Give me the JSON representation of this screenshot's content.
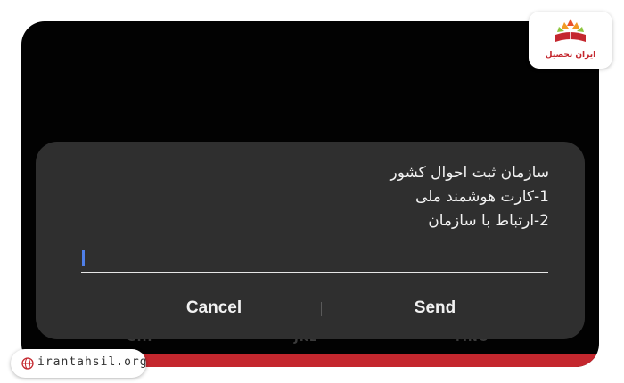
{
  "dialog": {
    "message_lines": [
      "سازمان ثبت احوال کشور",
      "1-کارت هوشمند ملی",
      "2-ارتباط با سازمان"
    ],
    "input_value": "",
    "cancel_label": "Cancel",
    "send_label": "Send"
  },
  "keypad": {
    "letters": [
      "GHI",
      "JKL",
      "MNO"
    ]
  },
  "watermark": {
    "brand_text": "ایران تحصیل",
    "site_url": "irantahsil.org"
  },
  "colors": {
    "dialog_bg": "#2f2f2f",
    "screen_bg": "#020202",
    "accent_red": "#c4272e",
    "caret_blue": "#4f7fe8"
  }
}
